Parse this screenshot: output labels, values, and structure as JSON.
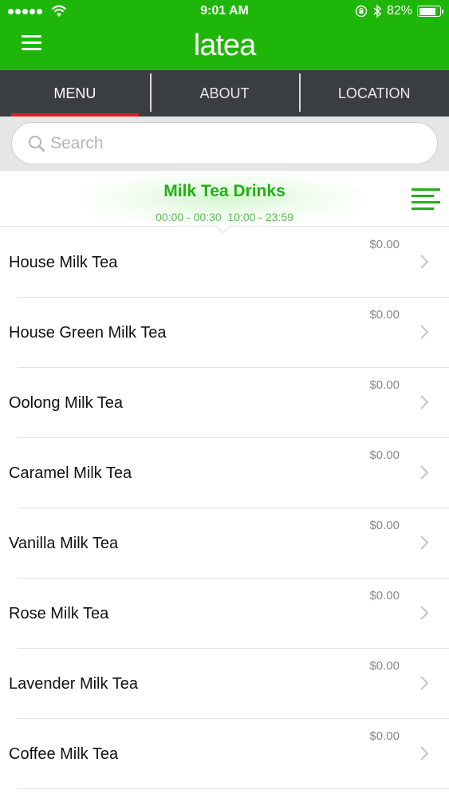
{
  "status_bar": {
    "time": "9:01 AM",
    "battery": "82%",
    "battery_level": 0.82,
    "icons": [
      "signal-dots-icon",
      "wifi-icon",
      "orientation-lock-icon",
      "bluetooth-icon",
      "battery-icon"
    ]
  },
  "header": {
    "app_title": "latea",
    "menu_icon": "hamburger-icon",
    "brand_color": "#1fb60a"
  },
  "tabs": [
    {
      "label": "MENU",
      "active": true
    },
    {
      "label": "ABOUT",
      "active": false
    },
    {
      "label": "LOCATION",
      "active": false
    }
  ],
  "search": {
    "placeholder": "Search",
    "icon": "search-icon"
  },
  "category": {
    "title": "Milk Tea Drinks",
    "hours": "00:00 - 00:30, 10:00 - 23:59",
    "filter_icon": "list-filter-icon",
    "accent_color": "#22b014"
  },
  "menu_items": [
    {
      "name": "House Milk Tea",
      "price": "$0.00"
    },
    {
      "name": "House Green Milk Tea",
      "price": "$0.00"
    },
    {
      "name": "Oolong Milk Tea",
      "price": "$0.00"
    },
    {
      "name": "Caramel Milk Tea",
      "price": "$0.00"
    },
    {
      "name": "Vanilla Milk Tea",
      "price": "$0.00"
    },
    {
      "name": "Rose Milk Tea",
      "price": "$0.00"
    },
    {
      "name": "Lavender Milk Tea",
      "price": "$0.00"
    },
    {
      "name": "Coffee Milk Tea",
      "price": "$0.00"
    }
  ]
}
